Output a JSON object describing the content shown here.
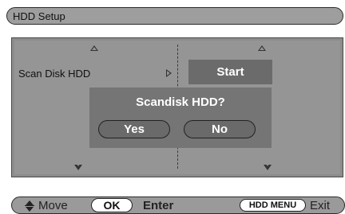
{
  "header": {
    "title": "HDD Setup"
  },
  "menu": {
    "item_label": "Scan Disk HDD",
    "start_button": "Start"
  },
  "dialog": {
    "title": "Scandisk HDD?",
    "yes_button": "Yes",
    "no_button": "No"
  },
  "footer": {
    "move_label": "Move",
    "ok_button": "OK",
    "enter_label": "Enter",
    "hddmenu_button": "HDD MENU",
    "exit_label": "Exit"
  },
  "icons": [
    "up-arrow-icon",
    "down-arrow-icon",
    "right-caret-icon",
    "move-updown-icon"
  ],
  "colors": {
    "panel_bg": "#959595",
    "button_bg": "#6b6b6b",
    "dialog_bg": "#757575",
    "bar_bg": "#9e9e9e"
  }
}
